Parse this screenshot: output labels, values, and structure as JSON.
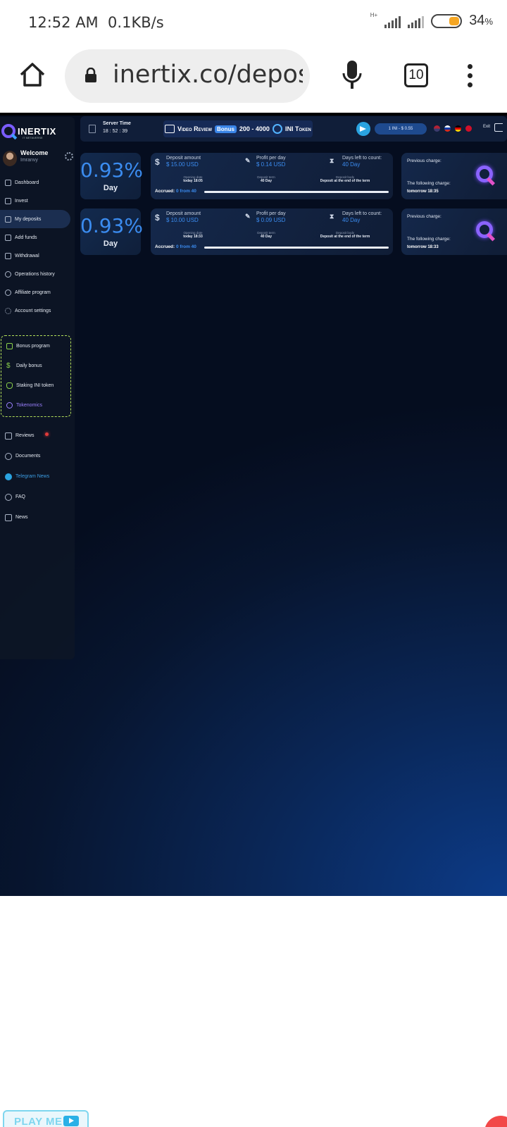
{
  "status_bar": {
    "time": "12:52 AM",
    "speed": "0.1KB/s",
    "network": "H+",
    "battery": "34",
    "battery_unit": "%"
  },
  "browser": {
    "url": "inertix.co/deposi",
    "url_faded": "t",
    "tab_count": "10"
  },
  "sidebar": {
    "logo": "INERTIX",
    "logo_sub": "IT METAVERSE",
    "welcome": "Welcome",
    "username": "Imranvy",
    "menu": [
      {
        "label": "Dashboard",
        "icon": "home-icon"
      },
      {
        "label": "Invest",
        "icon": "invest-icon"
      },
      {
        "label": "My deposits",
        "icon": "deposits-icon",
        "active": true
      },
      {
        "label": "Add funds",
        "icon": "add-funds-icon"
      },
      {
        "label": "Withdrawal",
        "icon": "withdrawal-icon"
      },
      {
        "label": "Operations history",
        "icon": "history-icon"
      },
      {
        "label": "Affiliate program",
        "icon": "affiliate-icon"
      },
      {
        "label": "Account settings",
        "icon": "settings-icon"
      }
    ],
    "bonus_menu": [
      {
        "label": "Bonus program",
        "icon": "gift-icon"
      },
      {
        "label": "Daily bonus",
        "icon": "dollar-icon"
      },
      {
        "label": "Staking INI token",
        "icon": "database-icon"
      },
      {
        "label": "Tokenomics",
        "icon": "logo-icon"
      }
    ],
    "menu2": [
      {
        "label": "Reviews",
        "icon": "reviews-icon"
      },
      {
        "label": "Documents",
        "icon": "documents-icon"
      },
      {
        "label": "Telegram News",
        "icon": "telegram-icon"
      },
      {
        "label": "FAQ",
        "icon": "question-icon"
      },
      {
        "label": "News",
        "icon": "news-icon"
      }
    ]
  },
  "topbar": {
    "server_time_label": "Server Time",
    "server_time": "18 : 52 : 39",
    "video_review": "Video Review",
    "bonus_badge": "Bonus",
    "bonus_range": "200 - 4000",
    "token": "INI Token",
    "rate": "1 INI - $ 0.55",
    "exit": "Exit",
    "colors": {
      "accent": "#3b8cf0",
      "telegram": "#2aa3e0",
      "brand": "#7a5cff"
    }
  },
  "deposits": [
    {
      "rate": "0.93%",
      "period": "Day",
      "deposit_label": "Deposit amount",
      "deposit_value": "$ 15.00 USD",
      "profit_label": "Profit per day",
      "profit_value": "$ 0.14 USD",
      "days_label": "Days left to count:",
      "days_value": "40 Day",
      "opening_label": "Opening date",
      "opening_value": "today 18:05",
      "term_label": "Deposit term",
      "term_value": "40 Day",
      "body_label": "Deposit body",
      "body_value": "Deposit at the end of the term",
      "accrued_label": "Accrued:",
      "accrued_value": "0 from 40",
      "progress": 0,
      "prev_charge": "Previous charge:",
      "next_charge": "The following charge:",
      "next_time": "tomorrow 18:35"
    },
    {
      "rate": "0.93%",
      "period": "Day",
      "deposit_label": "Deposit amount",
      "deposit_value": "$ 10.00 USD",
      "profit_label": "Profit per day",
      "profit_value": "$ 0.09 USD",
      "days_label": "Days left to count:",
      "days_value": "40 Day",
      "opening_label": "Opening date",
      "opening_value": "today 18:33",
      "term_label": "Deposit term",
      "term_value": "40 Day",
      "body_label": "Deposit body",
      "body_value": "Deposit at the end of the term",
      "accrued_label": "Accrued:",
      "accrued_value": "0 from 40",
      "progress": 0,
      "prev_charge": "Previous charge:",
      "next_charge": "The following charge:",
      "next_time": "tomorrow 18:33"
    }
  ],
  "floating": {
    "play_me": "PLAY ME"
  }
}
